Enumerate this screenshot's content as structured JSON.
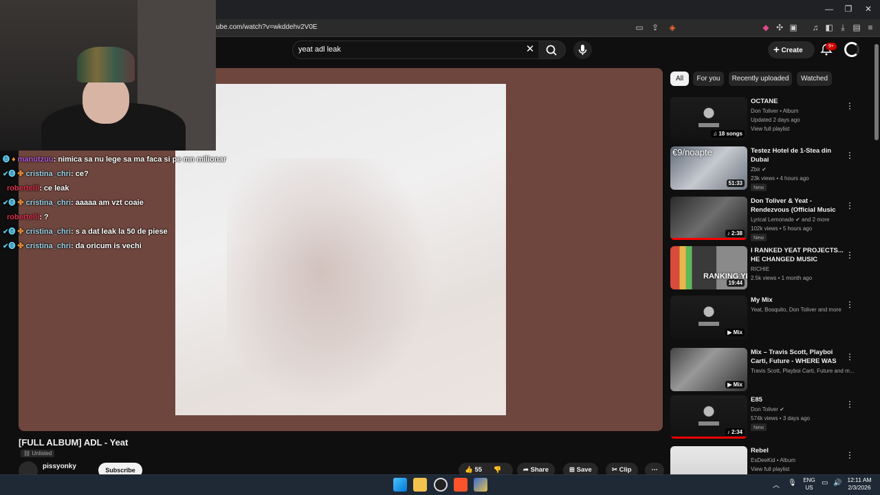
{
  "browser": {
    "url": "ube.com/watch?v=wkddehv2V0E"
  },
  "masthead": {
    "search_value": "yeat adl leak",
    "create_label": "Create",
    "notification_count": "9+"
  },
  "chat": [
    {
      "user": "manutzuu",
      "message": "nimica sa nu lege sa ma faca si pe mn milionar",
      "user_color": "#b25cd9",
      "badges": "🅑",
      "star": "♦"
    },
    {
      "user": "cristina_chri",
      "message": "ce?",
      "user_color": "#9ed3e6",
      "badges": "✔🅑",
      "star": "✤"
    },
    {
      "user": "robertelli",
      "message": "ce leak",
      "user_color": "#e0314f",
      "badges": "",
      "star": ""
    },
    {
      "user": "cristina_chri",
      "message": "aaaaa am vzt coaie",
      "user_color": "#9ed3e6",
      "badges": "✔🅑",
      "star": "✤"
    },
    {
      "user": "robertelli",
      "message": "?",
      "user_color": "#e0314f",
      "badges": "",
      "star": ""
    },
    {
      "user": "cristina_chri",
      "message": "s a dat leak la 50 de piese",
      "user_color": "#9ed3e6",
      "badges": "✔🅑",
      "star": "✤"
    },
    {
      "user": "cristina_chri",
      "message": "da oricum is vechi",
      "user_color": "#9ed3e6",
      "badges": "✔🅑",
      "star": "✤"
    }
  ],
  "chips": [
    "All",
    "For you",
    "Recently uploaded",
    "Watched"
  ],
  "related": [
    {
      "title": "OCTANE",
      "meta1": "Don Toliver • Album",
      "meta2": "Updated 2 days ago",
      "meta3": "View full playlist",
      "badge": "♫ 18 songs",
      "new": "",
      "progress": 0
    },
    {
      "title": "Testez Hotel de 1-Stea din Dubai",
      "meta1": "Zbir ✔",
      "meta2": "23k views • 4 hours ago",
      "meta3": "",
      "badge": "51:33",
      "new": "New",
      "progress": 0
    },
    {
      "title": "Don Toliver & Yeat - Rendezvous (Official Music Video)",
      "meta1": "Lyrical Lemonade ✔ and 2 more",
      "meta2": "102k views • 5 hours ago",
      "meta3": "",
      "badge": "♪ 2:38",
      "new": "New",
      "progress": 1.0
    },
    {
      "title": "I RANKED YEAT PROJECTS... HE CHANGED MUSIC",
      "meta1": "RICHIE",
      "meta2": "2.5k views • 1 month ago",
      "meta3": "",
      "badge": "19:44",
      "new": "",
      "progress": 0
    },
    {
      "title": "My Mix",
      "meta1": "Yeat, Bosquito, Don Toliver and more",
      "meta2": "",
      "meta3": "",
      "badge": "▶ Mix",
      "new": "",
      "progress": 0
    },
    {
      "title": "Mix – Travis Scott, Playboi Carti, Future - WHERE WAS YO...",
      "meta1": "Travis Scott, Playboi Carti, Future and m...",
      "meta2": "",
      "meta3": "",
      "badge": "▶ Mix",
      "new": "",
      "progress": 0
    },
    {
      "title": "E85",
      "meta1": "Don Toliver ✔",
      "meta2": "574k views • 3 days ago",
      "meta3": "",
      "badge": "♪ 2:34",
      "new": "New",
      "progress": 1.0
    },
    {
      "title": "Rebel",
      "meta1": "EsDeeKid • Album",
      "meta2": "View full playlist",
      "meta3": "",
      "badge": "",
      "new": "",
      "progress": 0
    }
  ],
  "thumb_overlay_text": "€9/noapte",
  "thumb_overlay_text2": "RANKING YEAT",
  "video": {
    "title": "[FULL ALBUM] ADL - Yeat",
    "visibility": "Unlisted",
    "channel": "pissyonky",
    "subscribe_label": "Subscribe",
    "likes": "55",
    "share_label": "Share",
    "save_label": "Save",
    "clip_label": "Clip"
  },
  "taskbar": {
    "lang_top": "ENG",
    "lang_bottom": "US",
    "time": "12:11 AM",
    "date": "2/3/2026"
  }
}
